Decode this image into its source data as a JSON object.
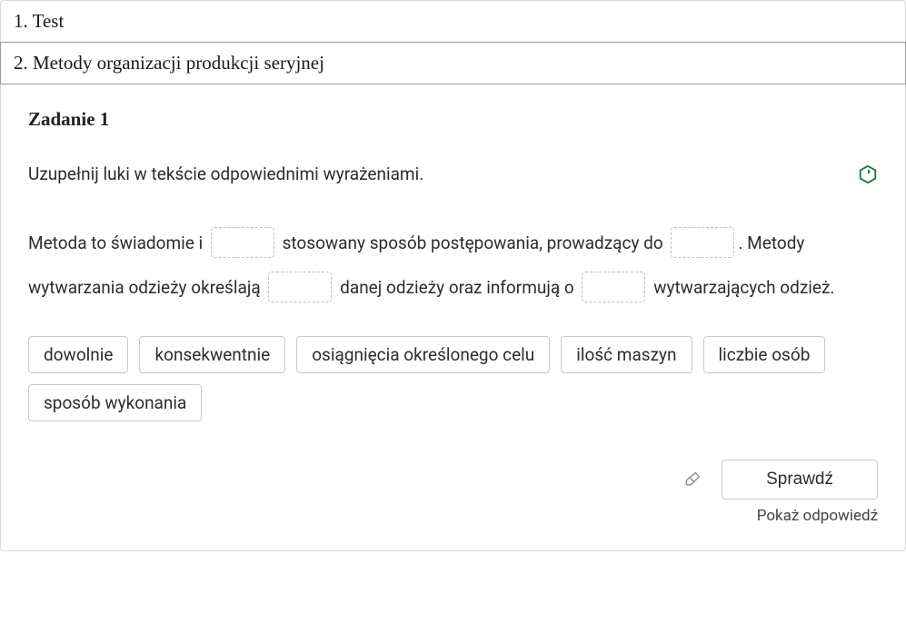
{
  "tabs": {
    "tab1": "1. Test",
    "tab2": "2. Metody organizacji produkcji seryjnej"
  },
  "task": {
    "title": "Zadanie 1",
    "instruction": "Uzupełnij luki w tekście odpowiednimi wyrażeniami.",
    "text": {
      "p1": "Metoda to świadomie i ",
      "p2": " stosowany sposób postępowania, prowadzący do ",
      "p3": ". Metody wytwarzania odzieży określają ",
      "p4": " danej odzieży oraz informują o ",
      "p5": " wytwarzających odzież."
    },
    "choices": [
      "dowolnie",
      "konsekwentnie",
      "osiągnięcia określonego celu",
      "ilość maszyn",
      "liczbie osób",
      "sposób wykonania"
    ],
    "check_label": "Sprawdź",
    "show_answer_label": "Pokaż odpowiedź"
  }
}
